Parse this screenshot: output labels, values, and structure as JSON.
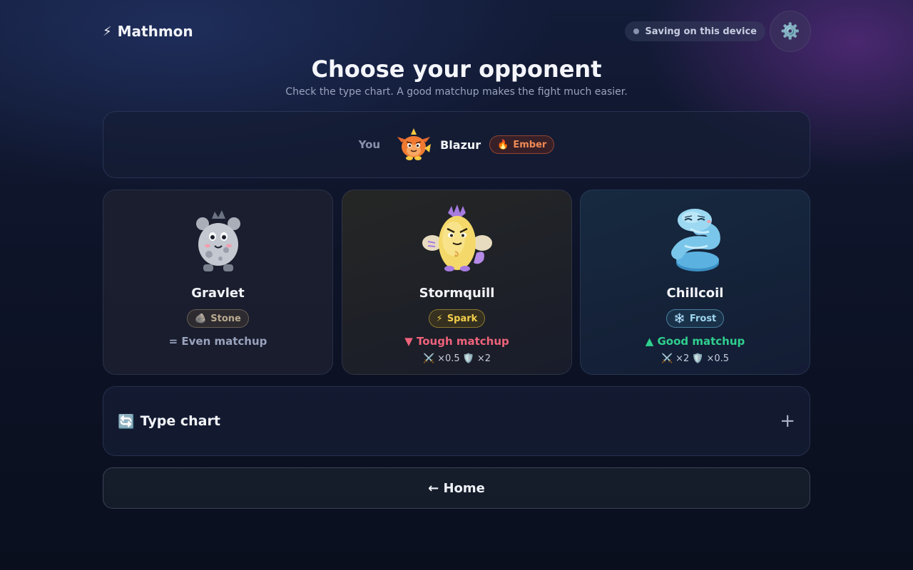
{
  "header": {
    "brand_icon": "⚡",
    "brand_name": "Mathmon",
    "save_status": "Saving on this device",
    "settings_icon": "⚙️"
  },
  "page": {
    "title": "Choose your opponent",
    "subtitle": "Check the type chart. A good matchup makes the fight much easier."
  },
  "player": {
    "label": "You",
    "name": "Blazur",
    "type_icon": "🔥",
    "type": "Ember"
  },
  "opponents": [
    {
      "name": "Gravlet",
      "type_icon": "🪨",
      "type": "Stone",
      "matchup": "= Even matchup",
      "attack_icon": "",
      "attack": "",
      "defense_icon": "",
      "defense": ""
    },
    {
      "name": "Stormquill",
      "type_icon": "⚡",
      "type": "Spark",
      "matchup": "▼ Tough matchup",
      "attack_icon": "⚔️",
      "attack": "×0.5",
      "defense_icon": "🛡️",
      "defense": "×2"
    },
    {
      "name": "Chillcoil",
      "type_icon": "❄️",
      "type": "Frost",
      "matchup": "▲ Good matchup",
      "attack_icon": "⚔️",
      "attack": "×2",
      "defense_icon": "🛡️",
      "defense": "×0.5"
    }
  ],
  "type_chart": {
    "icon": "🔄",
    "label": "Type chart",
    "toggle": "+"
  },
  "home_button": "← Home",
  "colors": {
    "ember": "#f08a55",
    "stone": "#b9a98f",
    "spark": "#f3cf4a",
    "frost": "#9fd6f0",
    "tough": "#f0637c",
    "good": "#2fcf8f",
    "even": "#9aa3bd"
  }
}
